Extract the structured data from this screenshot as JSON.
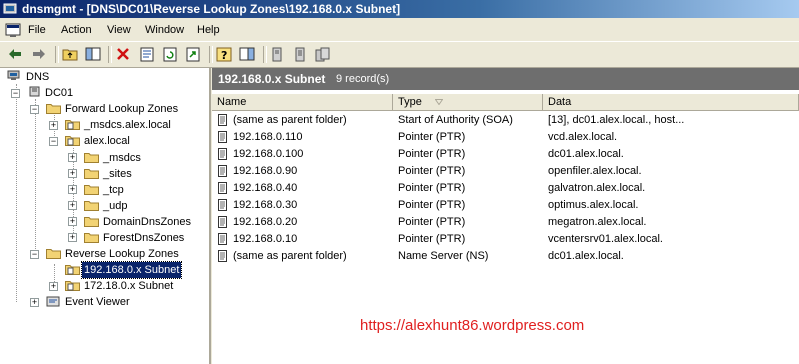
{
  "window": {
    "title": "dnsmgmt - [DNS\\DC01\\Reverse Lookup Zones\\192.168.0.x Subnet]"
  },
  "menu": {
    "file": "File",
    "action": "Action",
    "view": "View",
    "window": "Window",
    "help": "Help"
  },
  "tree": {
    "root": "DNS",
    "server": "DC01",
    "forward": "Forward Lookup Zones",
    "msdcs_zone": "_msdcs.alex.local",
    "alex": "alex.local",
    "sub_msdcs": "_msdcs",
    "sites": "_sites",
    "tcp": "_tcp",
    "udp": "_udp",
    "domaindns": "DomainDnsZones",
    "forestdns": "ForestDnsZones",
    "reverse": "Reverse Lookup Zones",
    "subnet192": "192.168.0.x Subnet",
    "subnet172": "172.18.0.x Subnet",
    "eventviewer": "Event Viewer"
  },
  "pane": {
    "title": "192.168.0.x Subnet",
    "count": "9 record(s)",
    "columns": {
      "name": "Name",
      "type": "Type",
      "data": "Data"
    }
  },
  "records": [
    {
      "name": "(same as parent folder)",
      "type": "Start of Authority (SOA)",
      "data": "[13], dc01.alex.local., host..."
    },
    {
      "name": "192.168.0.110",
      "type": "Pointer (PTR)",
      "data": "vcd.alex.local."
    },
    {
      "name": "192.168.0.100",
      "type": "Pointer (PTR)",
      "data": "dc01.alex.local."
    },
    {
      "name": "192.168.0.90",
      "type": "Pointer (PTR)",
      "data": "openfiler.alex.local."
    },
    {
      "name": "192.168.0.40",
      "type": "Pointer (PTR)",
      "data": "galvatron.alex.local."
    },
    {
      "name": "192.168.0.30",
      "type": "Pointer (PTR)",
      "data": "optimus.alex.local."
    },
    {
      "name": "192.168.0.20",
      "type": "Pointer (PTR)",
      "data": "megatron.alex.local."
    },
    {
      "name": "192.168.0.10",
      "type": "Pointer (PTR)",
      "data": "vcentersrv01.alex.local."
    },
    {
      "name": "(same as parent folder)",
      "type": "Name Server (NS)",
      "data": "dc01.alex.local."
    }
  ],
  "watermark": "https://alexhunt86.wordpress.com"
}
